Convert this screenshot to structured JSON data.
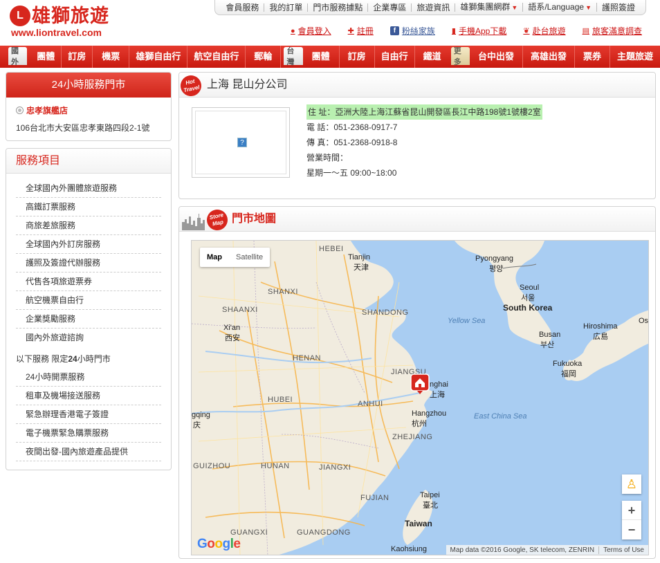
{
  "logo": {
    "mark": "L",
    "brand": "雄獅旅遊",
    "url": "www.liontravel.com"
  },
  "topnav": [
    {
      "label": "會員服務",
      "caret": false
    },
    {
      "label": "我的訂單",
      "caret": false
    },
    {
      "label": "門市服務據點",
      "caret": false
    },
    {
      "label": "企業專區",
      "caret": false
    },
    {
      "label": "旅遊資訊",
      "caret": false
    },
    {
      "label": "雄獅集團網群",
      "caret": true
    },
    {
      "label": "語系/Language",
      "caret": true
    },
    {
      "label": "護照簽證",
      "caret": false
    }
  ],
  "subnav": {
    "login": "會員登入",
    "register": "註冊",
    "fans": "粉絲家族",
    "app": "手機App下載",
    "taiwan": "赴台旅遊",
    "survey": "旅客滿意調查"
  },
  "mainnav": {
    "intl_tag": "國外",
    "intl_items": [
      "團體",
      "訂房",
      "機票",
      "雄獅自由行",
      "航空自由行",
      "郵輪"
    ],
    "tw_tag": "台灣",
    "tw_items": [
      "團體",
      "訂房",
      "自由行",
      "鐵道"
    ],
    "more_tag": "更多",
    "more_items": [
      "台中出發",
      "高雄出發",
      "票券",
      "主題旅遊"
    ]
  },
  "store24": {
    "title": "24小時服務門市",
    "store_name": "忠孝旗艦店",
    "address": "106台北市大安區忠孝東路四段2-1號"
  },
  "services": {
    "title": "服務項目",
    "items": [
      "全球國內外團體旅遊服務",
      "高鐵訂票服務",
      "商旅差旅服務",
      "全球國內外訂房服務",
      "護照及簽證代辦服務",
      "代售各項旅遊票券",
      "航空機票自由行",
      "企業獎勵服務",
      "國內外旅遊諮詢"
    ],
    "limited_prefix": "以下服務 限定",
    "limited_bold": "24",
    "limited_suffix": "小時門市",
    "limited_items": [
      "24小時開票服務",
      "租車及機場接送服務",
      "緊急辦理香港電子簽證",
      "電子機票緊急購票服務",
      "夜間出發-國內旅遊產品提供"
    ]
  },
  "office": {
    "badge": "Hot Travel",
    "title": "上海 昆山分公司",
    "image_missing": "?",
    "address": "住 址：亞洲大陸上海江蘇省昆山開發區長江中路198號1號樓2室",
    "phone": "電 話：051-2368-0917-7",
    "fax": "傳 真：051-2368-0918-8",
    "hours_label": "營業時間：",
    "hours": "星期一～五 09:00~18:00"
  },
  "map_panel": {
    "badge": "Store Map",
    "title": "門市地圖",
    "map_btn": "Map",
    "satellite_btn": "Satellite",
    "zoom_in": "+",
    "zoom_out": "−",
    "google": [
      "G",
      "o",
      "o",
      "g",
      "l",
      "e"
    ],
    "attribution": "Map data ©2016 Google, SK telecom, ZENRIN",
    "terms": "Terms of Use",
    "labels": {
      "hebei": "HEBEI",
      "tianjin1": "Tianjin",
      "tianjin2": "天津",
      "pyongyang1": "Pyongyang",
      "pyongyang2": "평양",
      "shanxi": "SHANXI",
      "seoul1": "Seoul",
      "seoul2": "서울",
      "shaanxi": "SHAANXI",
      "shandong": "SHANDONG",
      "southkorea": "South Korea",
      "yellowsea": "Yellow Sea",
      "xian1": "Xi'an",
      "xian2": "西安",
      "hiroshima1": "Hiroshima",
      "hiroshima2": "広島",
      "os": "Os",
      "busan1": "Busan",
      "busan2": "부산",
      "henan": "HENAN",
      "fukuoka1": "Fukuoka",
      "fukuoka2": "福岡",
      "jiangsu": "JIANGSU",
      "shanghai1": "nghai",
      "shanghai2": "上海",
      "hubei": "HUBEI",
      "anhui": "ANHUI",
      "chongqing1": "gqing",
      "chongqing2": "庆",
      "hangzhou1": "Hangzhou",
      "hangzhou2": "杭州",
      "eastchinasea": "East China Sea",
      "zhejiang": "ZHEJIANG",
      "guizhou": "GUIZHOU",
      "hunan": "HUNAN",
      "jiangxi": "JIANGXI",
      "fujian": "FUJIAN",
      "taipei1": "Taipei",
      "taipei2": "臺北",
      "taiwan": "Taiwan",
      "guangxi": "GUANGXI",
      "guangdong": "GUANGDONG",
      "kaohsiung": "Kaohsiung"
    }
  }
}
